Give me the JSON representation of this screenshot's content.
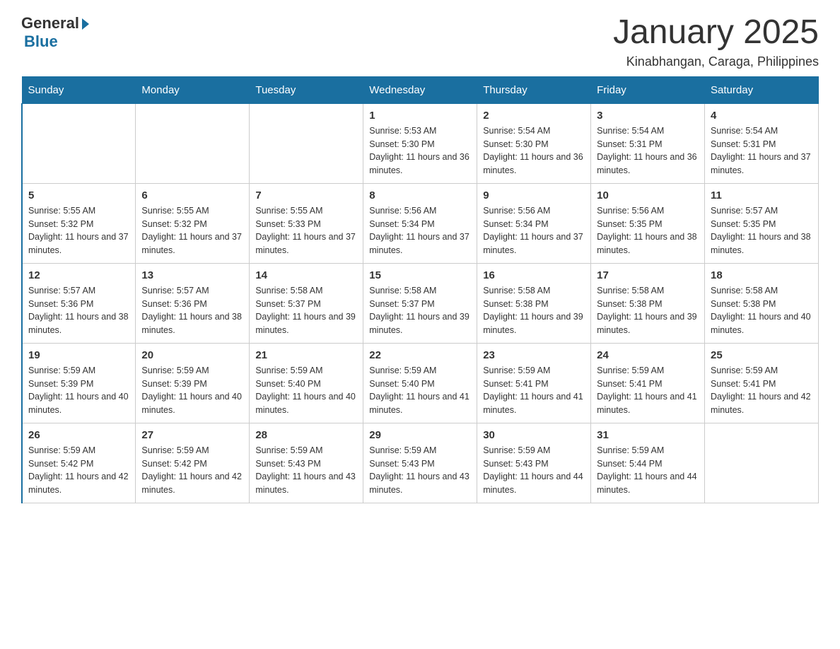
{
  "logo": {
    "general": "General",
    "blue": "Blue"
  },
  "title": "January 2025",
  "subtitle": "Kinabhangan, Caraga, Philippines",
  "days_of_week": [
    "Sunday",
    "Monday",
    "Tuesday",
    "Wednesday",
    "Thursday",
    "Friday",
    "Saturday"
  ],
  "weeks": [
    [
      {
        "day": "",
        "info": ""
      },
      {
        "day": "",
        "info": ""
      },
      {
        "day": "",
        "info": ""
      },
      {
        "day": "1",
        "info": "Sunrise: 5:53 AM\nSunset: 5:30 PM\nDaylight: 11 hours and 36 minutes."
      },
      {
        "day": "2",
        "info": "Sunrise: 5:54 AM\nSunset: 5:30 PM\nDaylight: 11 hours and 36 minutes."
      },
      {
        "day": "3",
        "info": "Sunrise: 5:54 AM\nSunset: 5:31 PM\nDaylight: 11 hours and 36 minutes."
      },
      {
        "day": "4",
        "info": "Sunrise: 5:54 AM\nSunset: 5:31 PM\nDaylight: 11 hours and 37 minutes."
      }
    ],
    [
      {
        "day": "5",
        "info": "Sunrise: 5:55 AM\nSunset: 5:32 PM\nDaylight: 11 hours and 37 minutes."
      },
      {
        "day": "6",
        "info": "Sunrise: 5:55 AM\nSunset: 5:32 PM\nDaylight: 11 hours and 37 minutes."
      },
      {
        "day": "7",
        "info": "Sunrise: 5:55 AM\nSunset: 5:33 PM\nDaylight: 11 hours and 37 minutes."
      },
      {
        "day": "8",
        "info": "Sunrise: 5:56 AM\nSunset: 5:34 PM\nDaylight: 11 hours and 37 minutes."
      },
      {
        "day": "9",
        "info": "Sunrise: 5:56 AM\nSunset: 5:34 PM\nDaylight: 11 hours and 37 minutes."
      },
      {
        "day": "10",
        "info": "Sunrise: 5:56 AM\nSunset: 5:35 PM\nDaylight: 11 hours and 38 minutes."
      },
      {
        "day": "11",
        "info": "Sunrise: 5:57 AM\nSunset: 5:35 PM\nDaylight: 11 hours and 38 minutes."
      }
    ],
    [
      {
        "day": "12",
        "info": "Sunrise: 5:57 AM\nSunset: 5:36 PM\nDaylight: 11 hours and 38 minutes."
      },
      {
        "day": "13",
        "info": "Sunrise: 5:57 AM\nSunset: 5:36 PM\nDaylight: 11 hours and 38 minutes."
      },
      {
        "day": "14",
        "info": "Sunrise: 5:58 AM\nSunset: 5:37 PM\nDaylight: 11 hours and 39 minutes."
      },
      {
        "day": "15",
        "info": "Sunrise: 5:58 AM\nSunset: 5:37 PM\nDaylight: 11 hours and 39 minutes."
      },
      {
        "day": "16",
        "info": "Sunrise: 5:58 AM\nSunset: 5:38 PM\nDaylight: 11 hours and 39 minutes."
      },
      {
        "day": "17",
        "info": "Sunrise: 5:58 AM\nSunset: 5:38 PM\nDaylight: 11 hours and 39 minutes."
      },
      {
        "day": "18",
        "info": "Sunrise: 5:58 AM\nSunset: 5:38 PM\nDaylight: 11 hours and 40 minutes."
      }
    ],
    [
      {
        "day": "19",
        "info": "Sunrise: 5:59 AM\nSunset: 5:39 PM\nDaylight: 11 hours and 40 minutes."
      },
      {
        "day": "20",
        "info": "Sunrise: 5:59 AM\nSunset: 5:39 PM\nDaylight: 11 hours and 40 minutes."
      },
      {
        "day": "21",
        "info": "Sunrise: 5:59 AM\nSunset: 5:40 PM\nDaylight: 11 hours and 40 minutes."
      },
      {
        "day": "22",
        "info": "Sunrise: 5:59 AM\nSunset: 5:40 PM\nDaylight: 11 hours and 41 minutes."
      },
      {
        "day": "23",
        "info": "Sunrise: 5:59 AM\nSunset: 5:41 PM\nDaylight: 11 hours and 41 minutes."
      },
      {
        "day": "24",
        "info": "Sunrise: 5:59 AM\nSunset: 5:41 PM\nDaylight: 11 hours and 41 minutes."
      },
      {
        "day": "25",
        "info": "Sunrise: 5:59 AM\nSunset: 5:41 PM\nDaylight: 11 hours and 42 minutes."
      }
    ],
    [
      {
        "day": "26",
        "info": "Sunrise: 5:59 AM\nSunset: 5:42 PM\nDaylight: 11 hours and 42 minutes."
      },
      {
        "day": "27",
        "info": "Sunrise: 5:59 AM\nSunset: 5:42 PM\nDaylight: 11 hours and 42 minutes."
      },
      {
        "day": "28",
        "info": "Sunrise: 5:59 AM\nSunset: 5:43 PM\nDaylight: 11 hours and 43 minutes."
      },
      {
        "day": "29",
        "info": "Sunrise: 5:59 AM\nSunset: 5:43 PM\nDaylight: 11 hours and 43 minutes."
      },
      {
        "day": "30",
        "info": "Sunrise: 5:59 AM\nSunset: 5:43 PM\nDaylight: 11 hours and 44 minutes."
      },
      {
        "day": "31",
        "info": "Sunrise: 5:59 AM\nSunset: 5:44 PM\nDaylight: 11 hours and 44 minutes."
      },
      {
        "day": "",
        "info": ""
      }
    ]
  ]
}
